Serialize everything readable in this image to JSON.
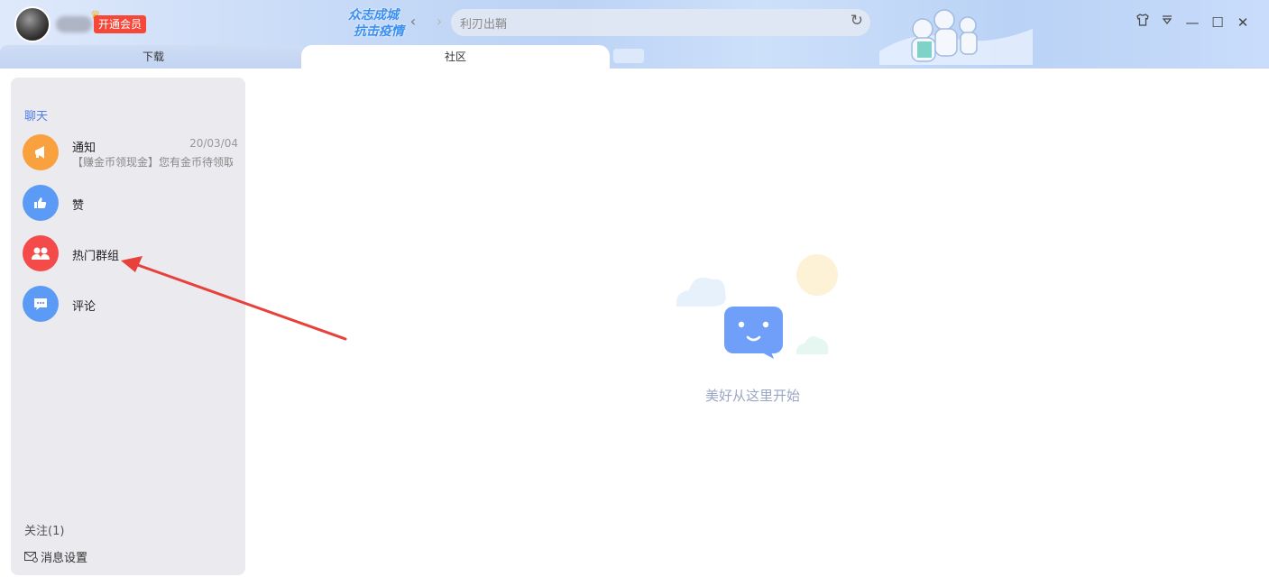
{
  "header": {
    "vip_button": "开通会员",
    "slogan_line1": "众志成城",
    "slogan_line2": "抗击疫情",
    "search_value": "利刃出鞘"
  },
  "tabs": [
    {
      "label": "下载",
      "active": false
    },
    {
      "label": "社区",
      "active": true
    }
  ],
  "sidebar": {
    "section_title": "聊天",
    "items": [
      {
        "title": "通知",
        "date": "20/03/04",
        "preview": "【赚金币领现金】您有金币待领取",
        "icon": "megaphone-icon",
        "color": "#f9a03f"
      },
      {
        "title": "赞",
        "icon": "thumbs-up-icon",
        "color": "#5b9bf5"
      },
      {
        "title": "热门群组",
        "icon": "group-icon",
        "color": "#f44a4a"
      },
      {
        "title": "评论",
        "icon": "comment-icon",
        "color": "#5b9bf5"
      }
    ],
    "follow_label": "关注(1)",
    "settings_label": "消息设置"
  },
  "main": {
    "empty_text": "美好从这里开始"
  },
  "colors": {
    "accent": "#4f7ee8",
    "annotation_arrow": "#e8403a"
  }
}
